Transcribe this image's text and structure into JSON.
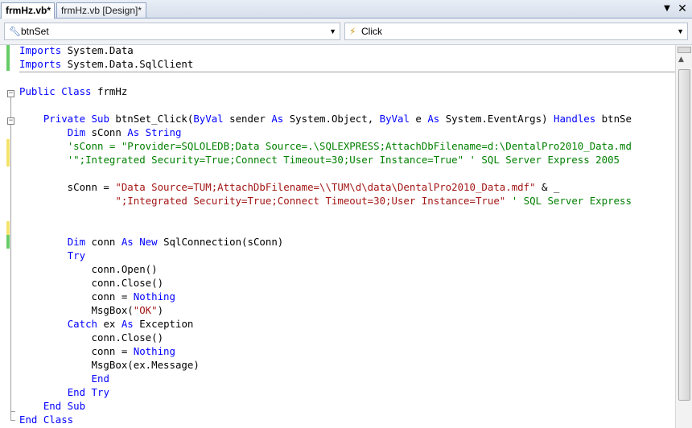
{
  "tabs": [
    {
      "label": "frmHz.vb*",
      "active": true
    },
    {
      "label": "frmHz.vb [Design]*",
      "active": false
    }
  ],
  "tab_controls": {
    "dropdown_icon": "▼",
    "close_icon": "✕"
  },
  "navbar": {
    "class_combo": {
      "icon": "class-member-icon",
      "value": "btnSet"
    },
    "method_combo": {
      "icon": "lightning-event-icon",
      "value": "Click"
    }
  },
  "code": [
    [
      {
        "t": "kw",
        "v": "Imports"
      },
      {
        "t": "n",
        "v": " System.Data"
      }
    ],
    [
      {
        "t": "kw",
        "v": "Imports"
      },
      {
        "t": "n",
        "v": " System.Data.SqlClient"
      }
    ],
    [],
    [
      {
        "t": "kw",
        "v": "Public Class"
      },
      {
        "t": "n",
        "v": " frmHz"
      }
    ],
    [],
    [
      {
        "t": "n",
        "v": "    "
      },
      {
        "t": "kw",
        "v": "Private Sub"
      },
      {
        "t": "n",
        "v": " btnSet_Click("
      },
      {
        "t": "kw",
        "v": "ByVal"
      },
      {
        "t": "n",
        "v": " sender "
      },
      {
        "t": "kw",
        "v": "As"
      },
      {
        "t": "n",
        "v": " System.Object, "
      },
      {
        "t": "kw",
        "v": "ByVal"
      },
      {
        "t": "n",
        "v": " e "
      },
      {
        "t": "kw",
        "v": "As"
      },
      {
        "t": "n",
        "v": " System.EventArgs) "
      },
      {
        "t": "kw",
        "v": "Handles"
      },
      {
        "t": "n",
        "v": " btnSe"
      }
    ],
    [
      {
        "t": "n",
        "v": "        "
      },
      {
        "t": "kw",
        "v": "Dim"
      },
      {
        "t": "n",
        "v": " sConn "
      },
      {
        "t": "kw",
        "v": "As String"
      }
    ],
    [
      {
        "t": "n",
        "v": "        "
      },
      {
        "t": "cmt",
        "v": "'sConn = \"Provider=SQLOLEDB;Data Source=.\\SQLEXPRESS;AttachDbFilename=d:\\DentalPro2010_Data.md"
      }
    ],
    [
      {
        "t": "n",
        "v": "        "
      },
      {
        "t": "cmt",
        "v": "'\";Integrated Security=True;Connect Timeout=30;User Instance=True\" ' SQL Server Express 2005"
      }
    ],
    [],
    [
      {
        "t": "n",
        "v": "        sConn = "
      },
      {
        "t": "str",
        "v": "\"Data Source=TUM;AttachDbFilename=\\\\TUM\\d\\data\\DentalPro2010_Data.mdf\""
      },
      {
        "t": "n",
        "v": " & _"
      }
    ],
    [
      {
        "t": "n",
        "v": "                "
      },
      {
        "t": "str",
        "v": "\";Integrated Security=True;Connect Timeout=30;User Instance=True\""
      },
      {
        "t": "n",
        "v": " "
      },
      {
        "t": "cmt",
        "v": "' SQL Server Express"
      }
    ],
    [],
    [],
    [
      {
        "t": "n",
        "v": "        "
      },
      {
        "t": "kw",
        "v": "Dim"
      },
      {
        "t": "n",
        "v": " conn "
      },
      {
        "t": "kw",
        "v": "As New"
      },
      {
        "t": "n",
        "v": " SqlConnection(sConn)"
      }
    ],
    [
      {
        "t": "n",
        "v": "        "
      },
      {
        "t": "kw",
        "v": "Try"
      }
    ],
    [
      {
        "t": "n",
        "v": "            conn.Open()"
      }
    ],
    [
      {
        "t": "n",
        "v": "            conn.Close()"
      }
    ],
    [
      {
        "t": "n",
        "v": "            conn = "
      },
      {
        "t": "kw",
        "v": "Nothing"
      }
    ],
    [
      {
        "t": "n",
        "v": "            MsgBox("
      },
      {
        "t": "str",
        "v": "\"OK\""
      },
      {
        "t": "n",
        "v": ")"
      }
    ],
    [
      {
        "t": "n",
        "v": "        "
      },
      {
        "t": "kw",
        "v": "Catch"
      },
      {
        "t": "n",
        "v": " ex "
      },
      {
        "t": "kw",
        "v": "As"
      },
      {
        "t": "n",
        "v": " Exception"
      }
    ],
    [
      {
        "t": "n",
        "v": "            conn.Close()"
      }
    ],
    [
      {
        "t": "n",
        "v": "            conn = "
      },
      {
        "t": "kw",
        "v": "Nothing"
      }
    ],
    [
      {
        "t": "n",
        "v": "            MsgBox(ex.Message)"
      }
    ],
    [
      {
        "t": "n",
        "v": "            "
      },
      {
        "t": "kw",
        "v": "End"
      }
    ],
    [
      {
        "t": "n",
        "v": "        "
      },
      {
        "t": "kw",
        "v": "End Try"
      }
    ],
    [
      {
        "t": "n",
        "v": "    "
      },
      {
        "t": "kw",
        "v": "End Sub"
      }
    ],
    [
      {
        "t": "kw",
        "v": "End Class"
      }
    ]
  ],
  "change_markers": [
    {
      "from": 0,
      "to": 1,
      "color": "#66cc66"
    },
    {
      "from": 7,
      "to": 8,
      "color": "#f5e26a"
    },
    {
      "from": 13,
      "to": 13,
      "color": "#f5e26a"
    },
    {
      "from": 14,
      "to": 14,
      "color": "#66cc66"
    }
  ],
  "colors": {
    "keyword": "#0000ff",
    "string": "#a31515",
    "comment": "#008000",
    "saved_change": "#66cc66",
    "unsaved_change": "#f5e26a"
  },
  "scrollbar": {
    "up_icon": "▲"
  }
}
